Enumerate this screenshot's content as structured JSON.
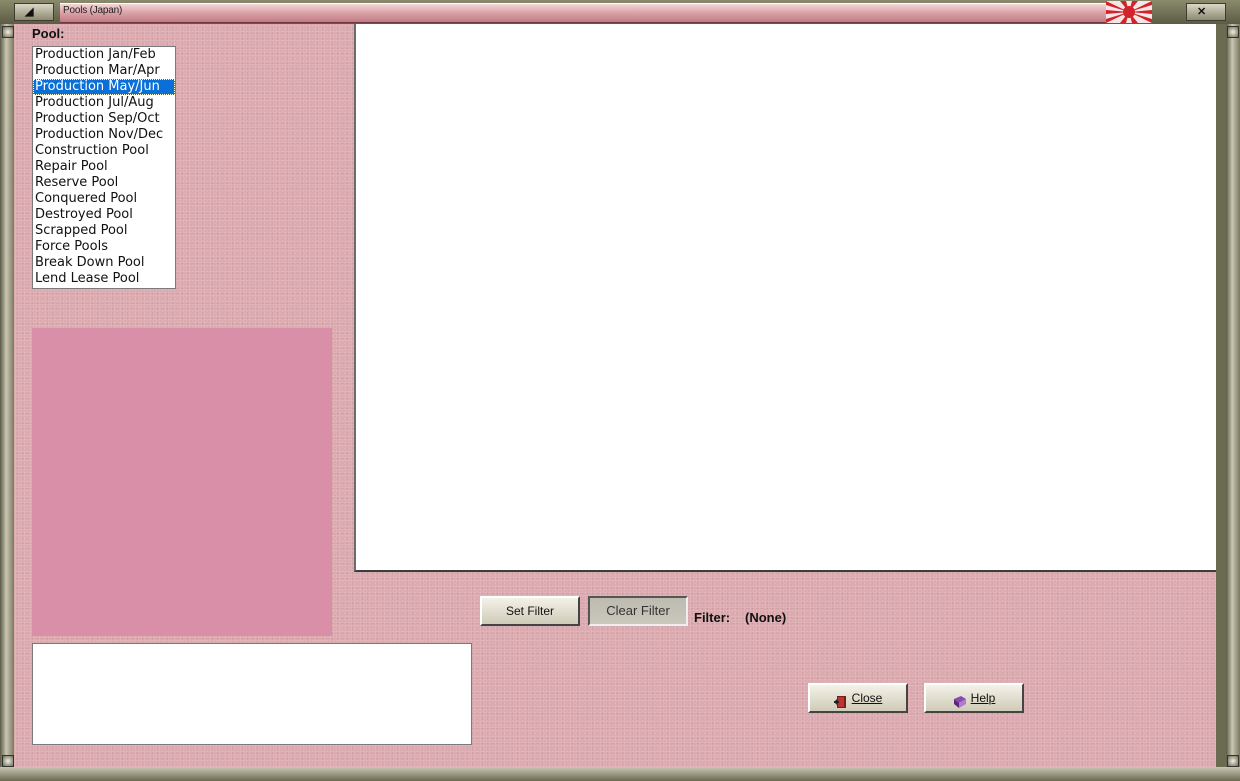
{
  "window": {
    "title": "Pools (Japan)"
  },
  "pool": {
    "label": "Pool:",
    "selected_index": 2,
    "items": [
      "Production Jan/Feb",
      "Production Mar/Apr",
      "Production May/Jun",
      "Production Jul/Aug",
      "Production Sep/Oct",
      "Production Nov/Dec",
      "Construction Pool",
      "Repair Pool",
      "Reserve Pool",
      "Conquered Pool",
      "Destroyed Pool",
      "Scrapped Pool",
      "Force Pools",
      "Break Down Pool",
      "Lend Lease Pool"
    ]
  },
  "filter": {
    "set_label": "Set Filter",
    "clear_label": "Clear Filter",
    "label": "Filter:",
    "value": "(None)"
  },
  "buttons": {
    "close_label": "Close",
    "help_label": "Help"
  },
  "colors": {
    "background": "#dba9ae",
    "preview": "#d98fa7",
    "selection": "#0a6fd6"
  }
}
